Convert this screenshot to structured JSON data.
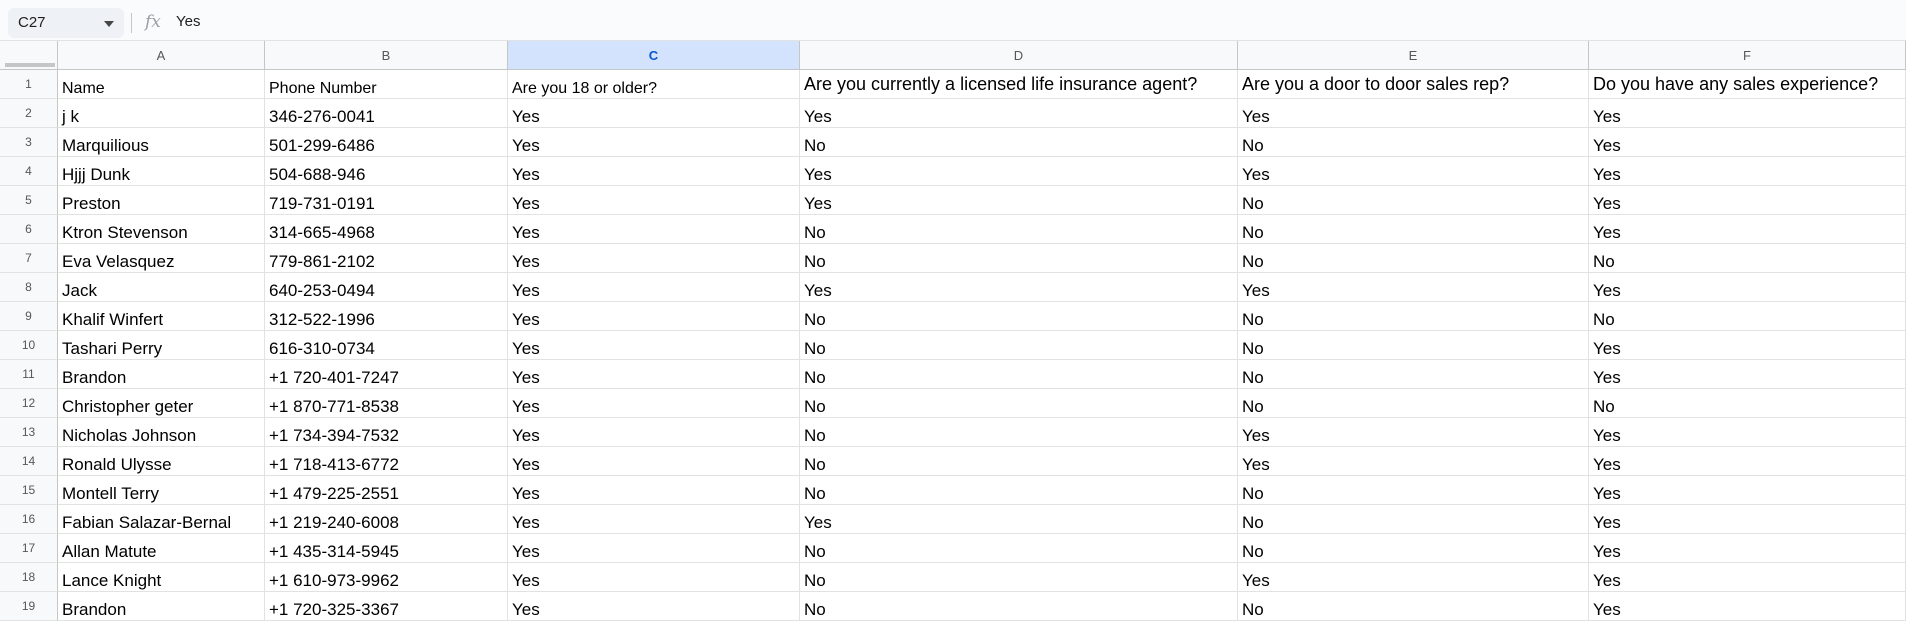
{
  "formula_bar": {
    "name_box": "C27",
    "fx_label": "fx",
    "formula": "Yes"
  },
  "columns": [
    "A",
    "B",
    "C",
    "D",
    "E",
    "F"
  ],
  "selected_column": "C",
  "header_row": {
    "row_number": "1",
    "cells": [
      "Name",
      "Phone Number",
      "Are you 18 or older?",
      "Are you currently a licensed life insurance agent?",
      "Are you a door to door sales rep?",
      "Do you have any sales experience?"
    ]
  },
  "rows": [
    {
      "num": "2",
      "cells": [
        "j k",
        "346-276-0041",
        "Yes",
        "Yes",
        "Yes",
        "Yes"
      ]
    },
    {
      "num": "3",
      "cells": [
        "Marquilious",
        "501-299-6486",
        "Yes",
        "No",
        "No",
        "Yes"
      ]
    },
    {
      "num": "4",
      "cells": [
        "Hjjj Dunk",
        "504-688-946",
        "Yes",
        "Yes",
        "Yes",
        "Yes"
      ]
    },
    {
      "num": "5",
      "cells": [
        "Preston",
        "719-731-0191",
        "Yes",
        "Yes",
        "No",
        "Yes"
      ]
    },
    {
      "num": "6",
      "cells": [
        "Ktron Stevenson",
        "314-665-4968",
        "Yes",
        "No",
        "No",
        "Yes"
      ]
    },
    {
      "num": "7",
      "cells": [
        "Eva Velasquez",
        "779-861-2102",
        "Yes",
        "No",
        "No",
        "No"
      ]
    },
    {
      "num": "8",
      "cells": [
        "Jack",
        "640-253-0494",
        "Yes",
        "Yes",
        "Yes",
        "Yes"
      ]
    },
    {
      "num": "9",
      "cells": [
        "Khalif Winfert",
        "312-522-1996",
        "Yes",
        "No",
        "No",
        "No"
      ]
    },
    {
      "num": "10",
      "cells": [
        "Tashari Perry",
        "616-310-0734",
        "Yes",
        "No",
        "No",
        "Yes"
      ]
    },
    {
      "num": "11",
      "cells": [
        "Brandon",
        "+1 720-401-7247",
        "Yes",
        "No",
        "No",
        "Yes"
      ]
    },
    {
      "num": "12",
      "cells": [
        "Christopher geter",
        "+1 870-771-8538",
        "Yes",
        "No",
        "No",
        "No"
      ]
    },
    {
      "num": "13",
      "cells": [
        "Nicholas Johnson",
        "+1 734-394-7532",
        "Yes",
        "No",
        "Yes",
        "Yes"
      ]
    },
    {
      "num": "14",
      "cells": [
        "Ronald Ulysse",
        "+1 718-413-6772",
        "Yes",
        "No",
        "Yes",
        "Yes"
      ]
    },
    {
      "num": "15",
      "cells": [
        "Montell Terry",
        "+1 479-225-2551",
        "Yes",
        "No",
        "No",
        "Yes"
      ]
    },
    {
      "num": "16",
      "cells": [
        "Fabian Salazar-Bernal",
        "+1 219-240-6008",
        "Yes",
        "Yes",
        "No",
        "Yes"
      ]
    },
    {
      "num": "17",
      "cells": [
        "Allan Matute",
        "+1 435-314-5945",
        "Yes",
        "No",
        "No",
        "Yes"
      ]
    },
    {
      "num": "18",
      "cells": [
        "Lance Knight",
        "+1 610-973-9962",
        "Yes",
        "No",
        "Yes",
        "Yes"
      ]
    },
    {
      "num": "19",
      "cells": [
        "Brandon",
        "+1 720-325-3367",
        "Yes",
        "No",
        "No",
        "Yes"
      ]
    }
  ],
  "colors": {
    "selected_header_bg": "#d3e3fd",
    "selected_header_text": "#0b57d0",
    "gridline": "#e1e3e1",
    "header_bg": "#f8f9fa"
  }
}
